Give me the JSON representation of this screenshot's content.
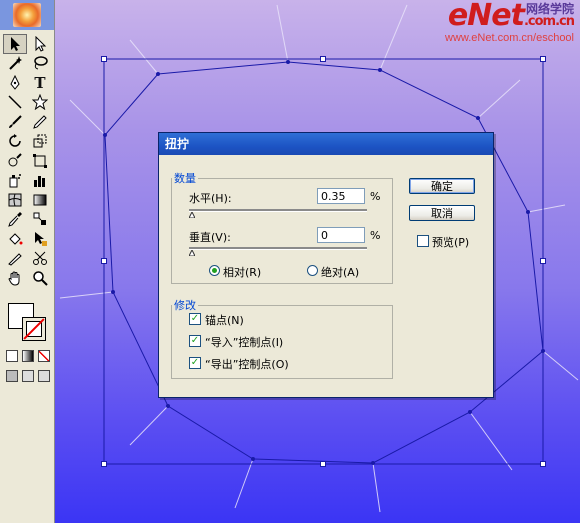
{
  "watermark": {
    "logo": "eNet",
    "logo_suffix": ".com.cn",
    "cn_text": "网络学院",
    "url": "www.eNet.com.cn/eschool"
  },
  "toolbox": {
    "tools": [
      {
        "name": "selection-tool",
        "icon": "arrow-icon"
      },
      {
        "name": "direct-selection-tool",
        "icon": "hollow-arrow-icon"
      },
      {
        "name": "magic-wand-tool",
        "icon": "magic-wand-icon"
      },
      {
        "name": "lasso-tool",
        "icon": "lasso-icon"
      },
      {
        "name": "pen-tool",
        "icon": "pen-icon"
      },
      {
        "name": "type-tool",
        "icon": "type-icon"
      },
      {
        "name": "line-tool",
        "icon": "line-icon"
      },
      {
        "name": "star-tool",
        "icon": "star-icon"
      },
      {
        "name": "paintbrush-tool",
        "icon": "brush-icon"
      },
      {
        "name": "pencil-tool",
        "icon": "pencil-icon"
      },
      {
        "name": "rotate-tool",
        "icon": "rotate-icon"
      },
      {
        "name": "scale-tool",
        "icon": "scale-icon"
      },
      {
        "name": "warp-tool",
        "icon": "warp-icon"
      },
      {
        "name": "free-transform-tool",
        "icon": "free-transform-icon"
      },
      {
        "name": "symbol-sprayer-tool",
        "icon": "sprayer-icon"
      },
      {
        "name": "column-graph-tool",
        "icon": "graph-icon"
      },
      {
        "name": "mesh-tool",
        "icon": "mesh-icon"
      },
      {
        "name": "gradient-tool",
        "icon": "gradient-icon"
      },
      {
        "name": "eyedropper-tool",
        "icon": "eyedropper-icon"
      },
      {
        "name": "blend-tool",
        "icon": "blend-icon"
      },
      {
        "name": "live-paint-bucket-tool",
        "icon": "paint-bucket-icon"
      },
      {
        "name": "live-paint-selection-tool",
        "icon": "paint-selection-icon"
      },
      {
        "name": "slice-tool",
        "icon": "slice-icon"
      },
      {
        "name": "scissors-tool",
        "icon": "scissors-icon"
      },
      {
        "name": "hand-tool",
        "icon": "hand-icon"
      },
      {
        "name": "zoom-tool",
        "icon": "zoom-icon"
      }
    ],
    "type_glyph": "T"
  },
  "dialog": {
    "title": "扭拧",
    "amount_group": "数量",
    "horizontal_label": "水平(H):",
    "horizontal_value": "0.35",
    "vertical_label": "垂直(V):",
    "vertical_value": "0",
    "percent": "%",
    "relative_label": "相对(R)",
    "absolute_label": "绝对(A)",
    "relative_selected": true,
    "modify_group": "修改",
    "anchor_points_label": "锚点(N)",
    "in_control_label": "“导入”控制点(I)",
    "out_control_label": "“导出”控制点(O)",
    "anchor_checked": true,
    "in_checked": true,
    "out_checked": true,
    "ok_label": "确定",
    "cancel_label": "取消",
    "preview_label": "预览(P)",
    "preview_checked": false
  },
  "colors": {
    "canvas_top": "#c8b2ea",
    "canvas_bottom": "#3b35f4",
    "path": "#1a1aa8",
    "dialog_title": "#1d54c4"
  }
}
